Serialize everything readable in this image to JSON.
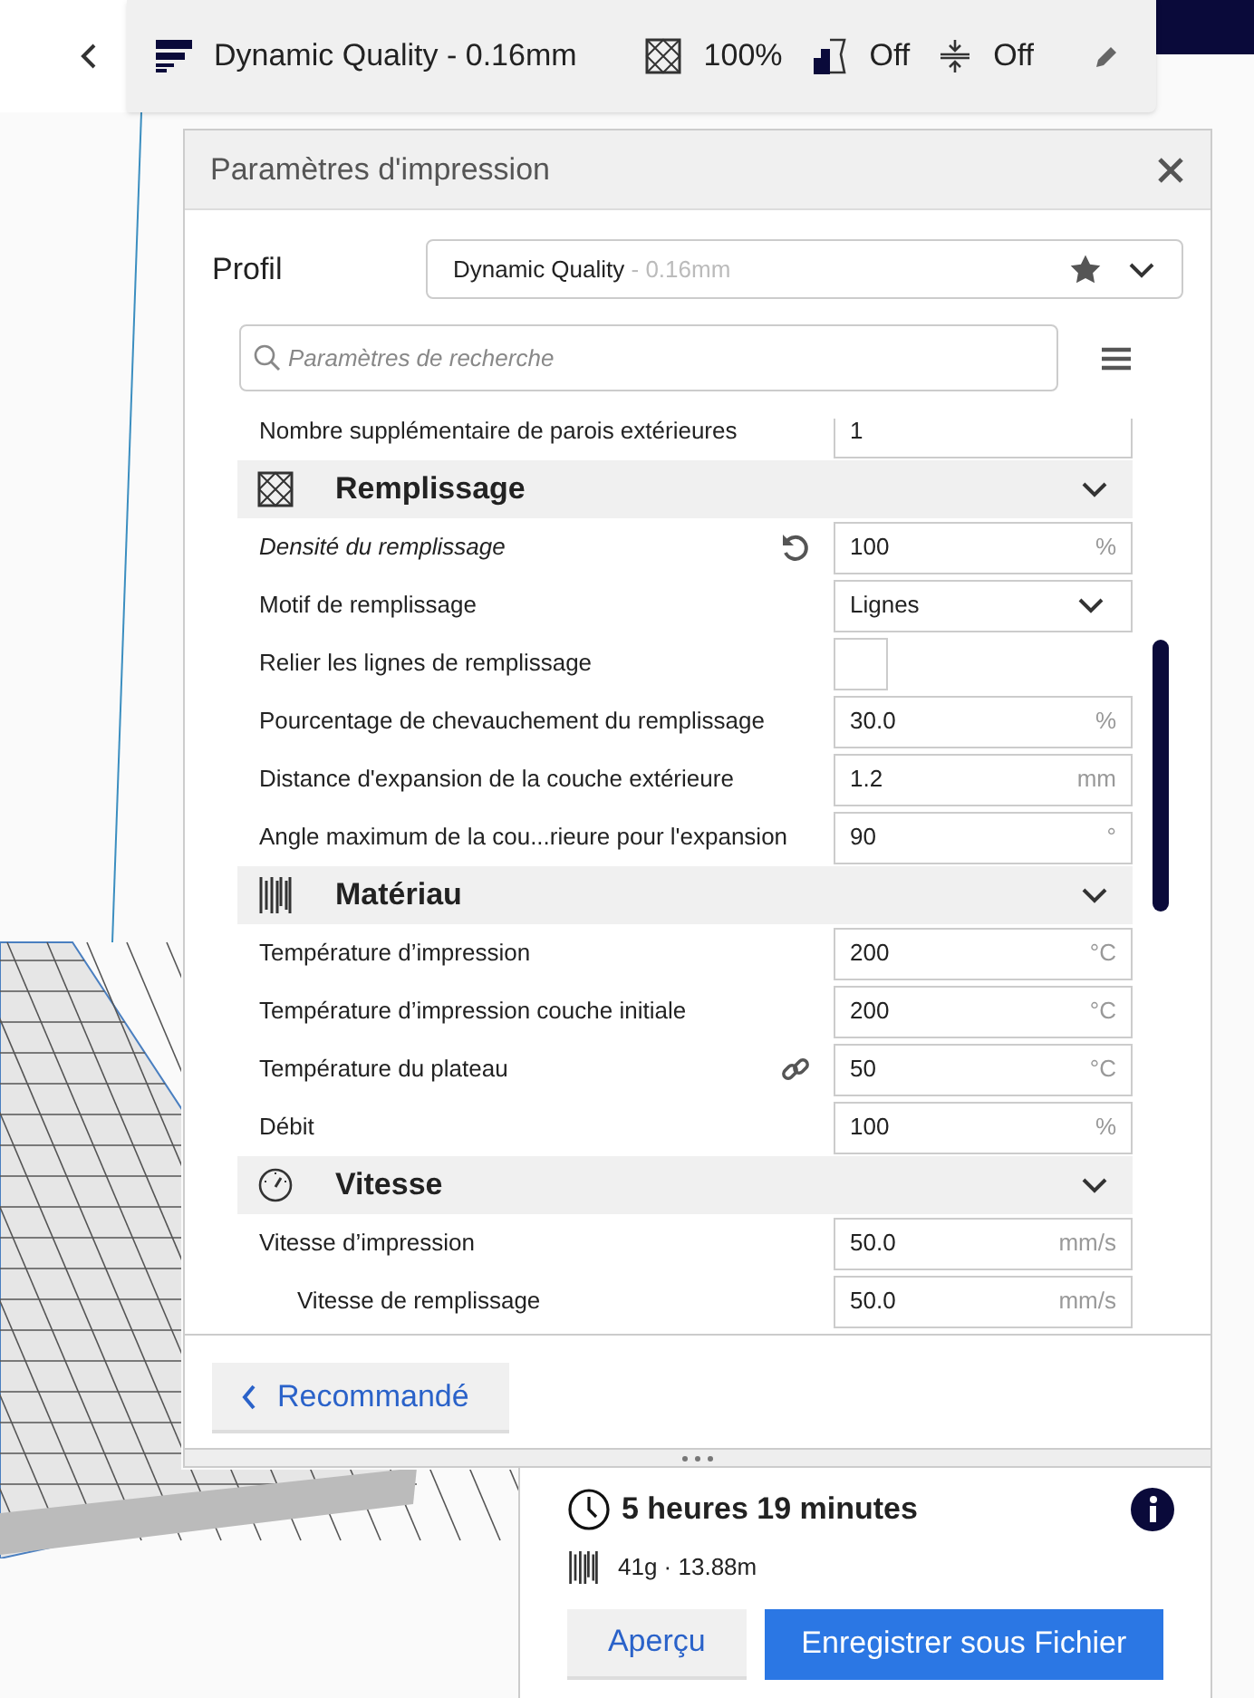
{
  "top_bar": {
    "profile": "Dynamic Quality - 0.16mm",
    "infill": "100%",
    "support": "Off",
    "adhesion": "Off"
  },
  "panel": {
    "title": "Paramètres d'impression",
    "profile_label": "Profil",
    "profile_name": "Dynamic Quality",
    "profile_suffix": " - 0.16mm",
    "search_placeholder": "Paramètres de recherche",
    "settings": [
      {
        "kind": "field",
        "label": "Nombre supplémentaire de parois extérieures",
        "value": "1"
      },
      {
        "kind": "category",
        "label": "Remplissage"
      },
      {
        "kind": "field",
        "label": "Densité du remplissage",
        "value": "100",
        "unit": "%",
        "modified": true
      },
      {
        "kind": "dropdown",
        "label": "Motif de remplissage",
        "value": "Lignes"
      },
      {
        "kind": "checkbox",
        "label": "Relier les lignes de remplissage",
        "checked": false
      },
      {
        "kind": "field",
        "label": "Pourcentage de chevauchement du remplissage",
        "value": "30.0",
        "unit": "%"
      },
      {
        "kind": "field",
        "label": "Distance d'expansion de la couche extérieure",
        "value": "1.2",
        "unit": "mm"
      },
      {
        "kind": "field",
        "label": "Angle maximum de la cou...rieure pour l'expansion",
        "value": "90",
        "unit": "°"
      },
      {
        "kind": "category",
        "label": "Matériau"
      },
      {
        "kind": "field",
        "label": "Température d’impression",
        "value": "200",
        "unit": "°C"
      },
      {
        "kind": "field",
        "label": "Température d’impression couche initiale",
        "value": "200",
        "unit": "°C"
      },
      {
        "kind": "field",
        "label": "Température du plateau",
        "value": "50",
        "unit": "°C",
        "linked": true
      },
      {
        "kind": "field",
        "label": "Débit",
        "value": "100",
        "unit": "%"
      },
      {
        "kind": "category",
        "label": "Vitesse"
      },
      {
        "kind": "field",
        "label": "Vitesse d’impression",
        "value": "50.0",
        "unit": "mm/s",
        "children": [
          {
            "kind": "field",
            "label": "Vitesse de remplissage",
            "value": "50.0",
            "unit": "mm/s"
          }
        ]
      }
    ],
    "back_button": "Recommandé"
  },
  "summary": {
    "time": "5 heures 19 minutes",
    "material": "41g · 13.88m",
    "preview_button": "Aperçu",
    "save_button": "Enregistrer sous Fichier"
  }
}
